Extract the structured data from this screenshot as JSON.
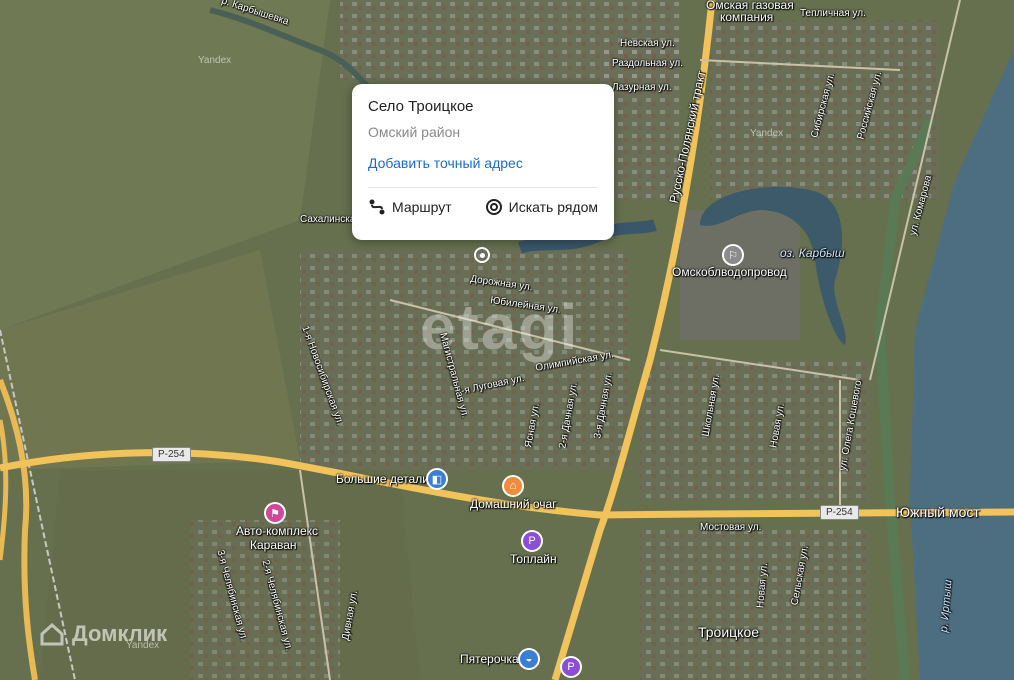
{
  "popup": {
    "title": "Село Троицкое",
    "subtitle": "Омский район",
    "add_address": "Добавить точный адрес",
    "route": "Маршрут",
    "search_nearby": "Искать рядом"
  },
  "labels": {
    "river_karbyshevka": "р. Карбышевка",
    "omsk_gas": "Омская газовая",
    "omsk_gas2": "компания",
    "nevskaya": "Невская ул.",
    "razdolnaya": "Раздольная ул.",
    "lazurnaya": "Лазурная ул.",
    "teplichnaya": "Тепличная ул.",
    "sibirskaya": "Сибирская ул.",
    "rossiyskaya": "Российская ул.",
    "komarova": "ул. Комарова",
    "tract": "Русско-Полянский тракт",
    "lake": "оз. Карбыш",
    "vodoprovod": "Омскоблводопровод",
    "sakhalinskaya": "Сахалинская",
    "dorozhnaya": "Дорожная ул.",
    "yubileynaya": "Юбилейная ул.",
    "olimpiyskaya": "Олимпийская ул.",
    "lugovaya": "3-я Луговая ул.",
    "nastavnaya": "Магистральная ул.",
    "novosibirskaya": "1-я Новосибирская ул.",
    "yasnaya": "Ясная ул.",
    "dachnaya1": "2-я Дачная ул.",
    "dachnaya2": "3-я Дачная ул.",
    "bolshie_detali": "Большие детали",
    "domashniy": "Домашний очаг",
    "avto1": "Авто-комплекс",
    "avto2": "Караван",
    "toplayn": "Топлайн",
    "yuzhny": "Южный мост",
    "r254a": "Р-254",
    "r254b": "Р-254",
    "shkolnaya": "Школьная ул.",
    "novaya": "Новая ул.",
    "kosheva": "ул. Олега Кошевого",
    "mostovaya": "Мостовая ул.",
    "troitskoe": "Троицкое",
    "pyaterochka": "Пятерочка",
    "irtysh": "р. Иртыш",
    "selskaya": "Сельская ул.",
    "chelyabinskaya3": "3-я Челябинская ул.",
    "chelyabinskaya2": "2-я Челябинская ул.",
    "divnaya": "Дивная ул.",
    "yandex1": "Yandex",
    "yandex2": "Yandex",
    "yandex3": "Yandex",
    "domclick": "Домклик",
    "etagi": "etagi"
  },
  "colors": {
    "road_major": "#f1c35a",
    "river": "#4d6e80",
    "terrain": "#5d6a4a",
    "link": "#1a6dcc",
    "poi_purple": "#8a4fd8",
    "poi_orange": "#f08a3c",
    "poi_blue": "#3a7fd6",
    "poi_pink": "#d0479b"
  }
}
